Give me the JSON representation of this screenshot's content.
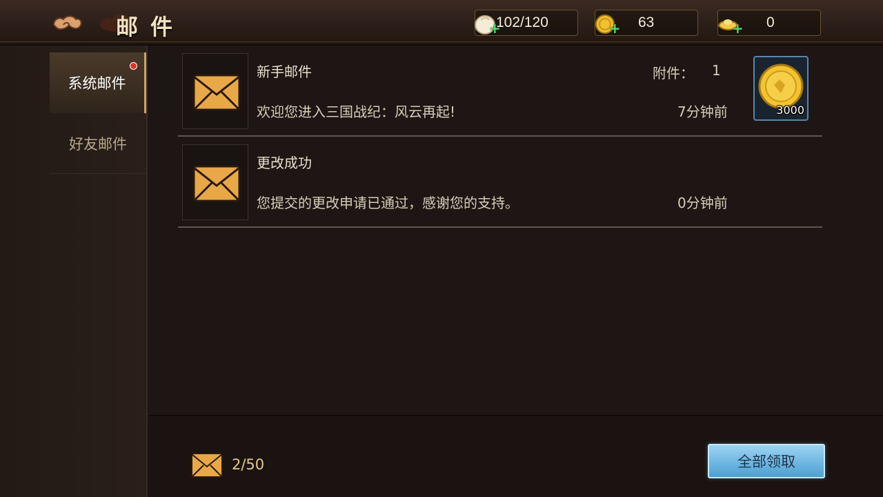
{
  "header": {
    "title": "邮件",
    "resources": [
      {
        "icon": "bun-icon",
        "value": "102/120"
      },
      {
        "icon": "gold-coin-icon",
        "value": "63"
      },
      {
        "icon": "gold-ingot-icon",
        "value": "0"
      }
    ],
    "plus_symbol": "+"
  },
  "sidebar": {
    "tabs": [
      {
        "label": "系统邮件",
        "active": true,
        "has_dot": true
      },
      {
        "label": "好友邮件",
        "active": false,
        "has_dot": false
      }
    ]
  },
  "mails": [
    {
      "subject": "新手邮件",
      "body": "欢迎您进入三国战纪：风云再起!",
      "time": "7分钟前",
      "attach_label": "附件：",
      "attach_count": "1",
      "attachment": {
        "icon": "gold-coin-icon",
        "qty": "3000"
      }
    },
    {
      "subject": "更改成功",
      "body": "您提交的更改申请已通过，感谢您的支持。",
      "time": "0分钟前"
    }
  ],
  "footer": {
    "mail_count": "2/50",
    "claim_all_label": "全部领取"
  },
  "colors": {
    "accent_gold": "#caa36a",
    "button_blue": "#6ab4e0",
    "notify_red": "#e0322a"
  }
}
